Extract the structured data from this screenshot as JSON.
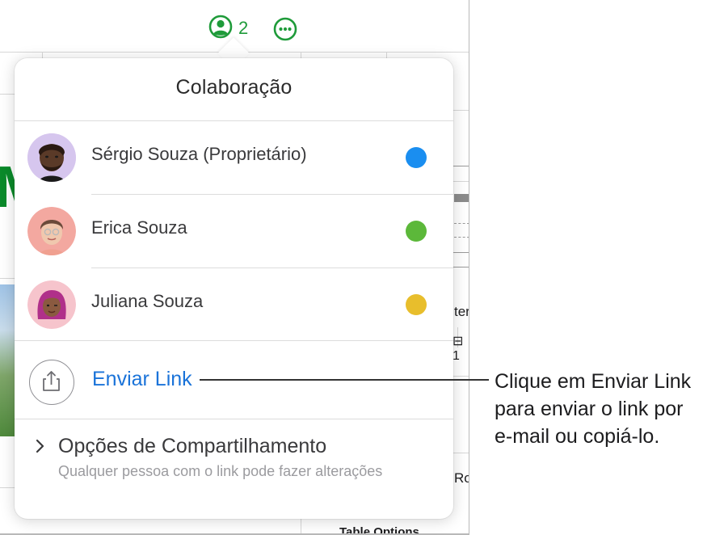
{
  "toolbar": {
    "collaborator_count": "2"
  },
  "background": {
    "fragments": {
      "ter": "ter",
      "one": "⊟ 1",
      "ro": "Ro",
      "table_options": "Table Options"
    }
  },
  "popover": {
    "title": "Colaboração",
    "participants": [
      {
        "name": "Sérgio Souza (Proprietário)",
        "color": "#1a8ef0"
      },
      {
        "name": "Erica Souza",
        "color": "#5cb83a"
      },
      {
        "name": "Juliana Souza",
        "color": "#e8be2c"
      }
    ],
    "send_link_label": "Enviar Link",
    "share_options": {
      "title": "Opções de Compartilhamento",
      "description": "Qualquer pessoa com o link pode fazer alterações"
    }
  },
  "callout": {
    "lines": [
      "Clique em Enviar Link",
      "para enviar o link por",
      "e-mail ou copiá-lo."
    ]
  }
}
